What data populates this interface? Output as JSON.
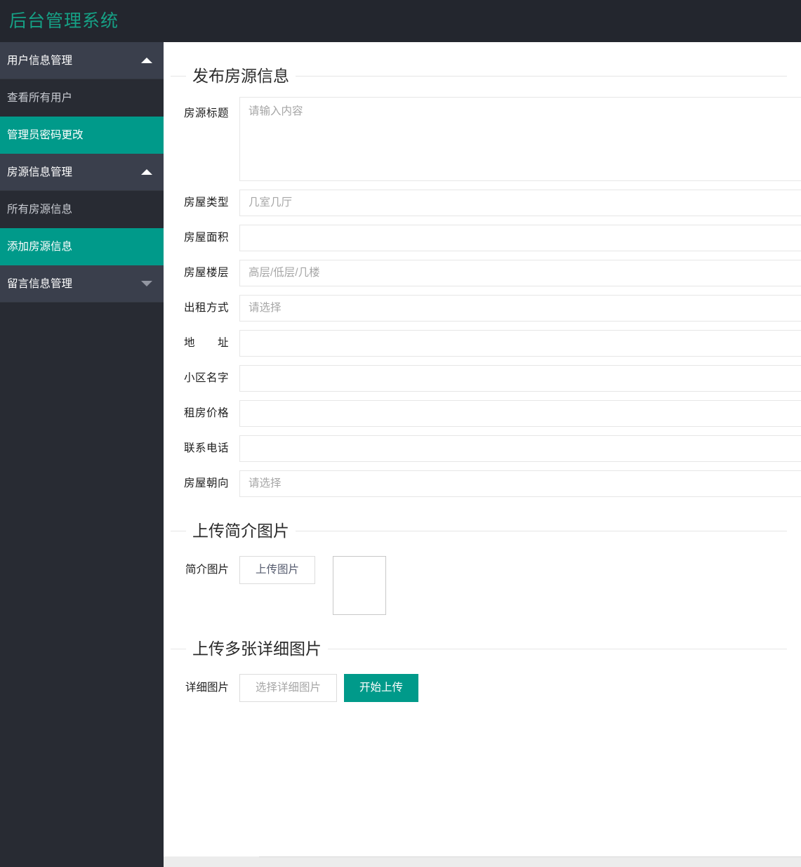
{
  "header": {
    "logo_text": "后台管理系统"
  },
  "sidebar": {
    "items": [
      {
        "label": "用户信息管理",
        "type": "parent",
        "icon": "chevron-up-icon",
        "expanded": true
      },
      {
        "label": "查看所有用户",
        "type": "child",
        "active": false
      },
      {
        "label": "管理员密码更改",
        "type": "child",
        "active": true
      },
      {
        "label": "房源信息管理",
        "type": "parent",
        "icon": "chevron-up-icon",
        "expanded": true
      },
      {
        "label": "所有房源信息",
        "type": "child",
        "active": false
      },
      {
        "label": "添加房源信息",
        "type": "child",
        "active": true
      },
      {
        "label": "留言信息管理",
        "type": "parent",
        "icon": "chevron-down-icon",
        "expanded": false
      }
    ]
  },
  "main": {
    "sections": [
      {
        "title": "发布房源信息"
      },
      {
        "title": "上传简介图片"
      },
      {
        "title": "上传多张详细图片"
      }
    ],
    "form": {
      "fields": [
        {
          "label": "房源标题",
          "placeholder": "请输入内容",
          "value": "",
          "control": "textarea"
        },
        {
          "label": "房屋类型",
          "placeholder": "几室几厅",
          "value": "",
          "control": "input"
        },
        {
          "label": "房屋面积",
          "placeholder": "",
          "value": "",
          "control": "input"
        },
        {
          "label": "房屋楼层",
          "placeholder": "高层/低层/几楼",
          "value": "",
          "control": "input"
        },
        {
          "label": "出租方式",
          "placeholder": "请选择",
          "value": "",
          "control": "select"
        },
        {
          "label": "地　　址",
          "placeholder": "",
          "value": "",
          "control": "input"
        },
        {
          "label": "小区名字",
          "placeholder": "",
          "value": "",
          "control": "input"
        },
        {
          "label": "租房价格",
          "placeholder": "",
          "value": "",
          "control": "input"
        },
        {
          "label": "联系电话",
          "placeholder": "",
          "value": "",
          "control": "input"
        },
        {
          "label": "房屋朝向",
          "placeholder": "请选择",
          "value": "",
          "control": "select"
        }
      ]
    },
    "intro_upload": {
      "label": "简介图片",
      "button_label": "上传图片",
      "preview_alt": ""
    },
    "detail_upload": {
      "label": "详细图片",
      "choose_label": "选择详细图片",
      "start_label": "开始上传"
    }
  },
  "colors": {
    "accent_teal": "#009a8a",
    "logo_teal": "#16a085",
    "topbar_dark": "#23262e",
    "sidebar_dark": "#282b33",
    "sidebar_parent": "#3a3f4c"
  }
}
